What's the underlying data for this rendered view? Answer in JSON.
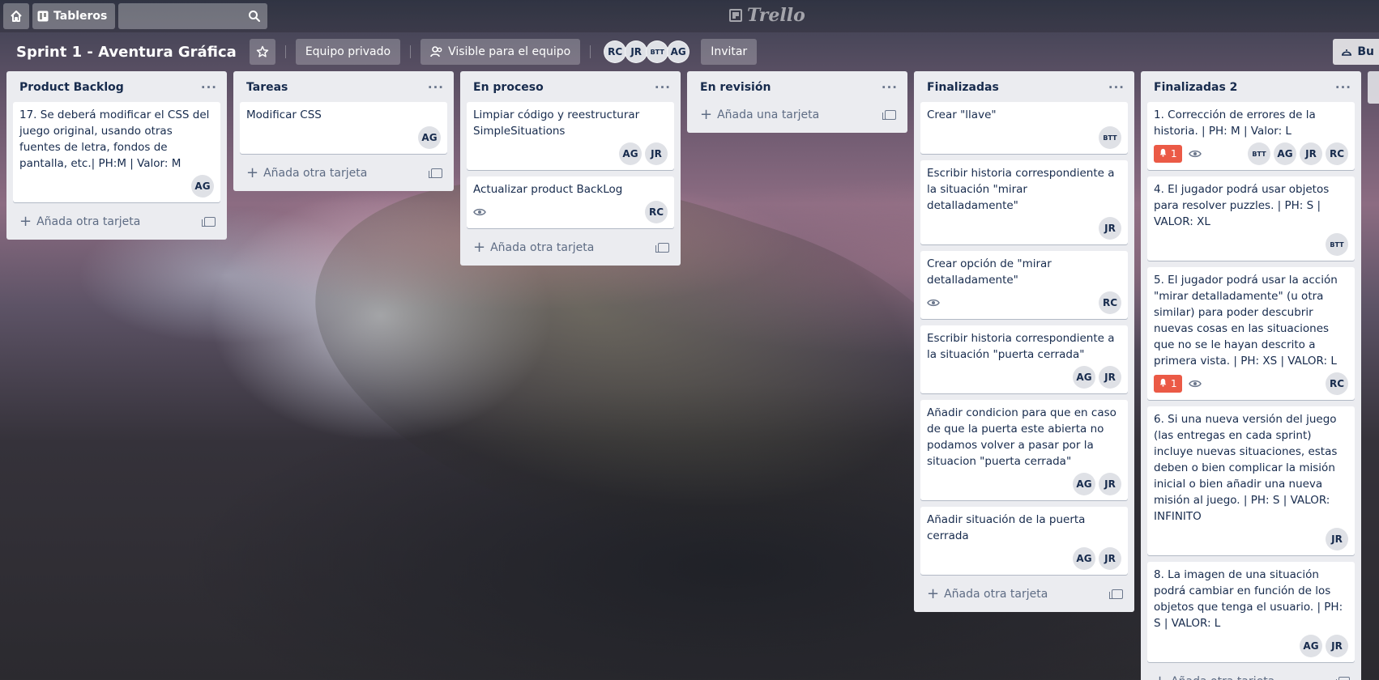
{
  "topbar": {
    "boards_label": "Tableros",
    "logo_text": "Trello"
  },
  "board": {
    "title": "Sprint 1 - Aventura Gráfica",
    "team_label": "Equipo privado",
    "visibility_label": "Visible para el equipo",
    "members": [
      "RC",
      "JR",
      "BTT",
      "AG"
    ],
    "invite_label": "Invitar",
    "right_button_label": "Bu"
  },
  "lists": [
    {
      "title": "Product Backlog",
      "cards": [
        {
          "text": "17. Se deberá modificar el CSS del juego original, usando otras fuentes de letra, fondos de pantalla, etc.| PH:M | Valor: M",
          "members": [
            "AG"
          ]
        }
      ],
      "add_label": "Añada otra tarjeta"
    },
    {
      "title": "Tareas",
      "cards": [
        {
          "text": "Modificar CSS",
          "members": [
            "AG"
          ]
        }
      ],
      "add_label": "Añada otra tarjeta"
    },
    {
      "title": "En proceso",
      "cards": [
        {
          "text": "Limpiar código y reestructurar SimpleSituations",
          "members": [
            "AG",
            "JR"
          ]
        },
        {
          "text": "Actualizar product BackLog",
          "watch": true,
          "members": [
            "RC"
          ]
        }
      ],
      "add_label": "Añada otra tarjeta"
    },
    {
      "title": "En revisión",
      "cards": [],
      "add_label": "Añada una tarjeta"
    },
    {
      "title": "Finalizadas",
      "cards": [
        {
          "text": "Crear \"llave\"",
          "members": [
            "BTT"
          ]
        },
        {
          "text": "Escribir historia correspondiente a la situación \"mirar detalladamente\"",
          "members": [
            "JR"
          ]
        },
        {
          "text": "Crear opción de \"mirar detalladamente\"",
          "watch": true,
          "members": [
            "RC"
          ]
        },
        {
          "text": "Escribir historia correspondiente a la situación \"puerta cerrada\"",
          "members": [
            "AG",
            "JR"
          ]
        },
        {
          "text": "Añadir condicion para que en caso de que la puerta este abierta no podamos volver a pasar por la situacion \"puerta cerrada\"",
          "members": [
            "AG",
            "JR"
          ]
        },
        {
          "text": "Añadir situación de la puerta cerrada",
          "members": [
            "AG",
            "JR"
          ]
        }
      ],
      "add_label": "Añada otra tarjeta"
    },
    {
      "title": "Finalizadas 2",
      "cards": [
        {
          "text": "1. Corrección de errores de la historia. | PH: M | Valor: L",
          "alert": "1",
          "watch": true,
          "members": [
            "BTT",
            "AG",
            "JR",
            "RC"
          ]
        },
        {
          "text": "4. El jugador podrá usar objetos para resolver puzzles. | PH: S | VALOR: XL",
          "members": [
            "BTT"
          ]
        },
        {
          "text": "5. El jugador podrá usar la acción \"mirar detalladamente\" (u otra similar) para poder descubrir nuevas cosas en las situaciones que no se le hayan descrito a primera vista. | PH: XS | VALOR: L",
          "alert": "1",
          "watch": true,
          "members": [
            "RC"
          ]
        },
        {
          "text": "6. Si una nueva versión del juego (las entregas en cada sprint) incluye nuevas situaciones, estas deben o bien complicar la misión inicial o bien añadir una nueva misión al juego. | PH: S | VALOR: INFINITO",
          "members": [
            "JR"
          ]
        },
        {
          "text": "8. La imagen de una situación podrá cambiar en función de los objetos que tenga el usuario. | PH: S | VALOR: L",
          "members": [
            "AG",
            "JR"
          ]
        }
      ],
      "add_label": "Añada otra tarjeta"
    }
  ]
}
